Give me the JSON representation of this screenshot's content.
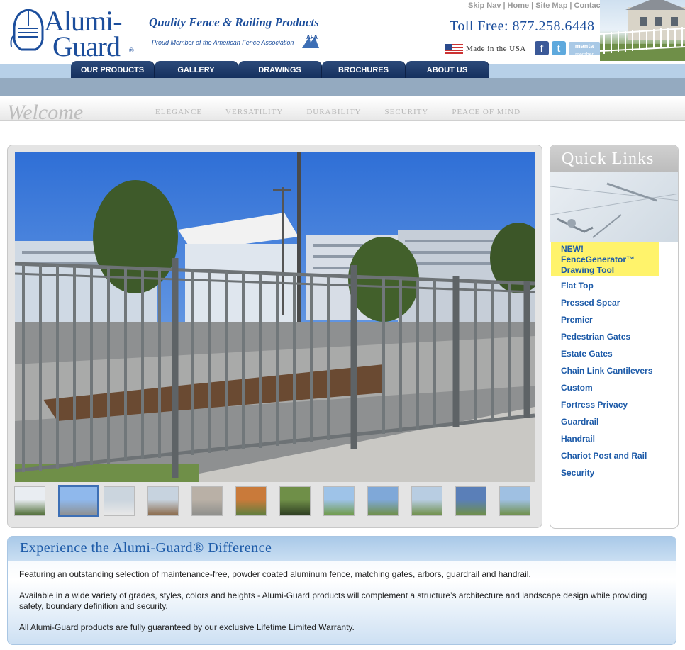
{
  "header": {
    "logo_line1": "Alumi-",
    "logo_line2": "Guard",
    "logo_reg": "®",
    "tagline": "Quality Fence & Railing Products",
    "afa_text": "Proud Member of the American Fence Association",
    "afa_label": "AFA",
    "utility_links": [
      "Skip Nav",
      "Home",
      "Site Map",
      "Contact"
    ],
    "toll_free": "Toll Free: 877.258.6448",
    "made_in_usa": "Made in the USA",
    "manta_label": "manta",
    "manta_sub": "member",
    "facebook_glyph": "f",
    "twitter_glyph": "t"
  },
  "nav": {
    "tabs": [
      "OUR PRODUCTS",
      "GALLERY",
      "DRAWINGS",
      "BROCHURES",
      "ABOUT US"
    ]
  },
  "welcome": {
    "title": "Welcome",
    "values": [
      "ELEGANCE",
      "VERSATILITY",
      "DURABILITY",
      "SECURITY",
      "PEACE OF MIND"
    ]
  },
  "gallery": {
    "thumbnail_count": 12,
    "active_thumbnail": 2
  },
  "quick_links": {
    "title": "Quick Links",
    "featured_line1": "NEW!",
    "featured_line2": "FenceGenerator™",
    "featured_line3": "Drawing Tool",
    "items": [
      "Flat Top",
      "Pressed Spear",
      "Premier",
      "Pedestrian Gates",
      "Estate Gates",
      "Chain Link Cantilevers",
      "Custom",
      "Fortress Privacy",
      "Guardrail",
      "Handrail",
      "Chariot Post and Rail",
      "Security"
    ]
  },
  "difference": {
    "title": "Experience the Alumi-Guard® Difference",
    "paragraphs": [
      "Featuring an outstanding selection of maintenance-free, powder coated aluminum fence, matching gates, arbors, guardrail and handrail.",
      "Available in a wide variety of grades, styles, colors and heights - Alumi-Guard products will complement a structure’s architecture and landscape design while providing safety, boundary definition and security.",
      "All Alumi-Guard products are fully guaranteed by our exclusive Lifetime Limited Warranty."
    ]
  },
  "colors": {
    "brand_blue": "#1c4e9c",
    "nav_dark": "#15305e",
    "link_blue": "#1c5aa8",
    "highlight_yellow": "#fff36b"
  }
}
